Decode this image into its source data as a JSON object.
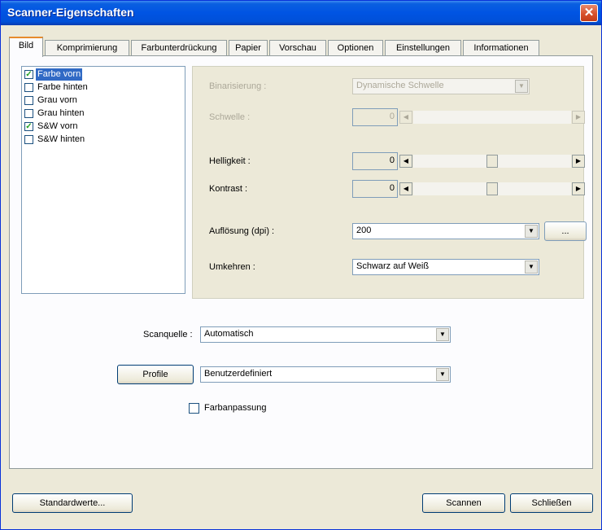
{
  "window": {
    "title": "Scanner-Eigenschaften",
    "close_glyph": "✕"
  },
  "tabs": [
    {
      "label": "Bild",
      "active": true
    },
    {
      "label": "Komprimierung",
      "active": false
    },
    {
      "label": "Farbunterdrückung",
      "active": false
    },
    {
      "label": "Papier",
      "active": false
    },
    {
      "label": "Vorschau",
      "active": false
    },
    {
      "label": "Optionen",
      "active": false
    },
    {
      "label": "Einstellungen",
      "active": false
    },
    {
      "label": "Informationen",
      "active": false
    }
  ],
  "image_list": [
    {
      "label": "Farbe vorn",
      "checked": true,
      "selected": true
    },
    {
      "label": "Farbe hinten",
      "checked": false,
      "selected": false
    },
    {
      "label": "Grau vorn",
      "checked": false,
      "selected": false
    },
    {
      "label": "Grau hinten",
      "checked": false,
      "selected": false
    },
    {
      "label": "S&W vorn",
      "checked": true,
      "selected": false
    },
    {
      "label": "S&W hinten",
      "checked": false,
      "selected": false
    }
  ],
  "settings": {
    "binarization": {
      "label": "Binarisierung :",
      "value": "Dynamische Schwelle",
      "enabled": false
    },
    "threshold": {
      "label": "Schwelle :",
      "value": "0",
      "enabled": false
    },
    "brightness": {
      "label": "Helligkeit :",
      "value": "0",
      "slider_fraction": 0.5
    },
    "contrast": {
      "label": "Kontrast :",
      "value": "0",
      "slider_fraction": 0.5
    },
    "resolution": {
      "label": "Auflösung (dpi) :",
      "value": "200",
      "more_button": "..."
    },
    "invert": {
      "label": "Umkehren :",
      "value": "Schwarz auf Weiß"
    }
  },
  "scan_source": {
    "label": "Scanquelle :",
    "value": "Automatisch"
  },
  "profile": {
    "button_label": "Profile",
    "value": "Benutzerdefiniert"
  },
  "color_matching": {
    "label": "Farbanpassung",
    "checked": false
  },
  "footer": {
    "defaults_button": "Standardwerte...",
    "scan_button": "Scannen",
    "close_button": "Schließen"
  },
  "icons": {
    "arrow_down": "▼",
    "arrow_left": "◀",
    "arrow_right": "▶",
    "check": "✓"
  }
}
